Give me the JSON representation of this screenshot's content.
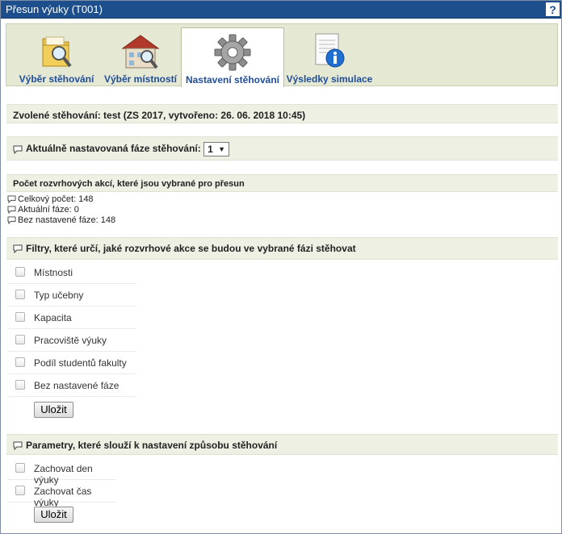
{
  "window": {
    "title": "Přesun výuky (T001)",
    "help_label": "?"
  },
  "tabs": [
    {
      "label": "Výběr stěhování",
      "icon": "folder-search-icon",
      "active": false
    },
    {
      "label": "Výběr místností",
      "icon": "building-search-icon",
      "active": false
    },
    {
      "label": "Nastavení stěhování",
      "icon": "gear-icon",
      "active": true
    },
    {
      "label": "Výsledky simulace",
      "icon": "document-info-icon",
      "active": false
    }
  ],
  "selected_move": {
    "text": "Zvolené stěhování: test (ZS 2017, vytvořeno: 26. 06. 2018 10:45)"
  },
  "phase": {
    "label": "Aktuálně nastavovaná fáze stěhování:",
    "selected": "1"
  },
  "counts": {
    "title": "Počet rozvrhových akcí, které jsou vybrané pro přesun",
    "lines": [
      "Celkový počet: 148",
      "Aktuální fáze: 0",
      "Bez nastavené fáze: 148"
    ]
  },
  "filters": {
    "title": "Filtry, které určí, jaké rozvrhové akce se budou ve vybrané fázi stěhovat",
    "items": [
      "Místnosti",
      "Typ učebny",
      "Kapacita",
      "Pracoviště výuky",
      "Podíl studentů fakulty",
      "Bez nastavené fáze"
    ],
    "save_label": "Uložit"
  },
  "params": {
    "title": "Parametry, které slouží k nastavení způsobu stěhování",
    "items": [
      "Zachovat den výuky",
      "Zachovat čas výuky"
    ],
    "save_label": "Uložit"
  },
  "colors": {
    "titlebar": "#1d4f8c",
    "tab_label": "#1f4d99",
    "section_bg": "#eef0e4"
  }
}
